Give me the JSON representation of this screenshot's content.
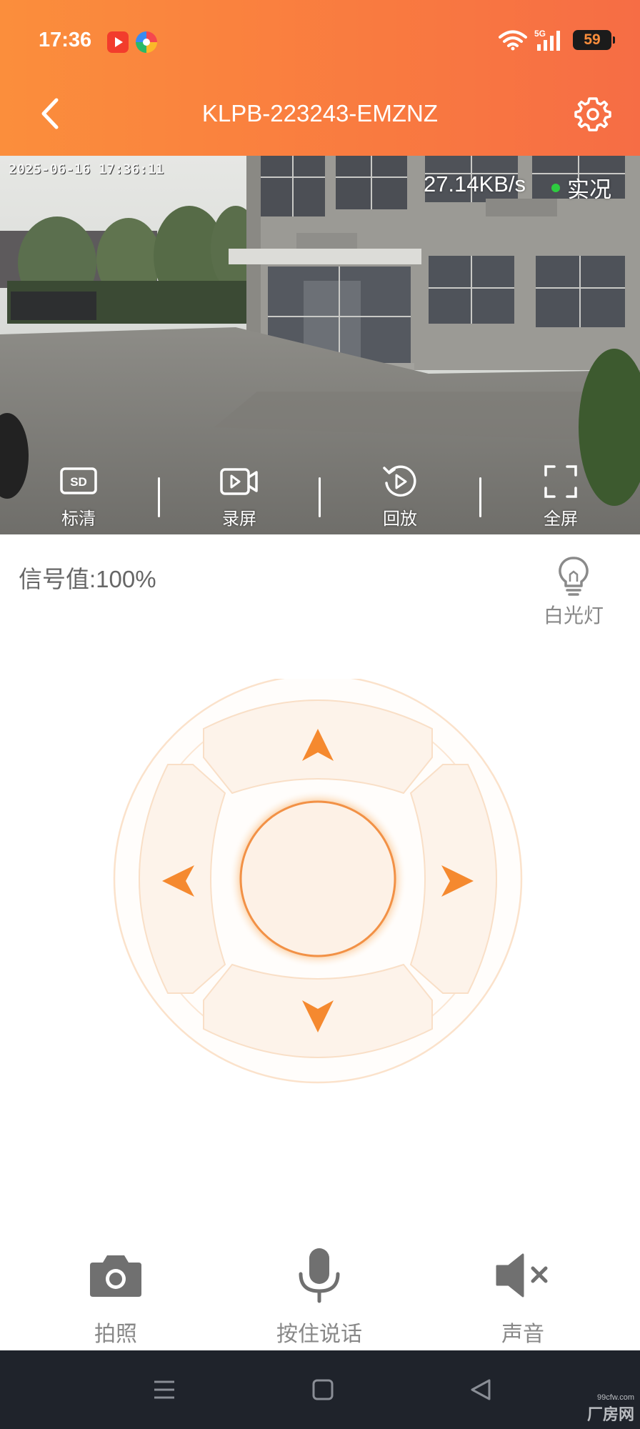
{
  "status_bar": {
    "time": "17:36",
    "battery": "59",
    "network": "5G"
  },
  "header": {
    "title": "KLPB-223243-EMZNZ",
    "back_icon": "chevron-left-icon",
    "settings_icon": "gear-icon",
    "gradient_start": "#fb8e3c",
    "gradient_end": "#f66d45"
  },
  "video": {
    "timestamp": "2025-06-16 17:36:11",
    "speed": "27.14KB/s",
    "live_label": "实况",
    "live_dot_color": "#2ecc40",
    "controls": [
      {
        "label": "标清",
        "icon": "sd-icon",
        "badge": "SD"
      },
      {
        "label": "录屏",
        "icon": "record-video-icon"
      },
      {
        "label": "回放",
        "icon": "playback-icon"
      },
      {
        "label": "全屏",
        "icon": "fullscreen-icon"
      }
    ]
  },
  "info": {
    "signal": "信号值:100%",
    "light_label": "白光灯",
    "light_icon": "lightbulb-icon"
  },
  "ptz": {
    "accent": "#f5892f",
    "directions": [
      "up",
      "down",
      "left",
      "right"
    ]
  },
  "actions": [
    {
      "label": "拍照",
      "icon": "camera-icon"
    },
    {
      "label": "按住说话",
      "icon": "microphone-icon"
    },
    {
      "label": "声音",
      "icon": "speaker-muted-icon"
    }
  ],
  "nav": {
    "menu_icon": "menu-icon",
    "home_icon": "home-icon",
    "back_icon": "back-triangle-icon"
  },
  "watermark": {
    "site": "99cfw.com",
    "text": "厂房网"
  }
}
